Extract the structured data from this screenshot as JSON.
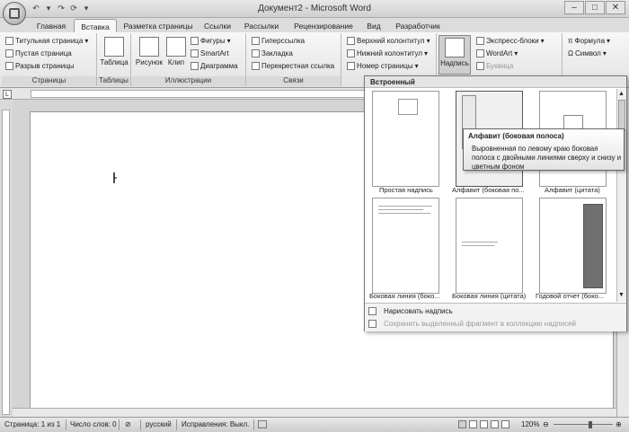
{
  "window": {
    "title": "Документ2 - Microsoft Word"
  },
  "tabs": [
    "Главная",
    "Вставка",
    "Разметка страницы",
    "Ссылки",
    "Рассылки",
    "Рецензирование",
    "Вид",
    "Разработчик"
  ],
  "active_tab": "Вставка",
  "ribbon": {
    "pages": {
      "label": "Страницы",
      "items": [
        "Титульная страница",
        "Пустая страница",
        "Разрыв страницы"
      ]
    },
    "tables": {
      "label": "Таблицы",
      "button": "Таблица"
    },
    "illustrations": {
      "label": "Иллюстрации",
      "picture": "Рисунок",
      "clip": "Клип",
      "shapes": "Фигуры",
      "smartart": "SmartArt",
      "chart": "Диаграмма"
    },
    "links": {
      "label": "Связи",
      "items": [
        "Гиперссылка",
        "Закладка",
        "Перекрестная ссылка"
      ]
    },
    "headfoot": {
      "items": [
        "Верхний колонтитул",
        "Нижний колонтитул",
        "Номер страницы"
      ]
    },
    "text": {
      "textbox": "Надпись",
      "items": [
        "Экспресс-блоки",
        "WordArt",
        "Буквица"
      ]
    },
    "symbols": {
      "items": [
        "Формула",
        "Символ"
      ]
    }
  },
  "gallery": {
    "header": "Встроенный",
    "items": [
      "Простая надпись",
      "Алфавит (боковая по...",
      "Алфавит (цитата)",
      "Боковая линия (боко...",
      "Боковая линия (цитата)",
      "Годовой отчет (боко..."
    ],
    "footer": {
      "draw": "Нарисовать надпись",
      "save": "Сохранить выделенный фрагмент в коллекцию надписей"
    }
  },
  "tooltip": {
    "title": "Алфавит (боковая полоса)",
    "text": "Выровненная по левому краю боковая полоса с двойными линиями сверху и снизу и цветным фоном"
  },
  "statusbar": {
    "page": "Страница: 1 из 1",
    "words": "Число слов: 0",
    "language": "русский",
    "track": "Исправления: Выкл.",
    "zoom": "120%"
  }
}
